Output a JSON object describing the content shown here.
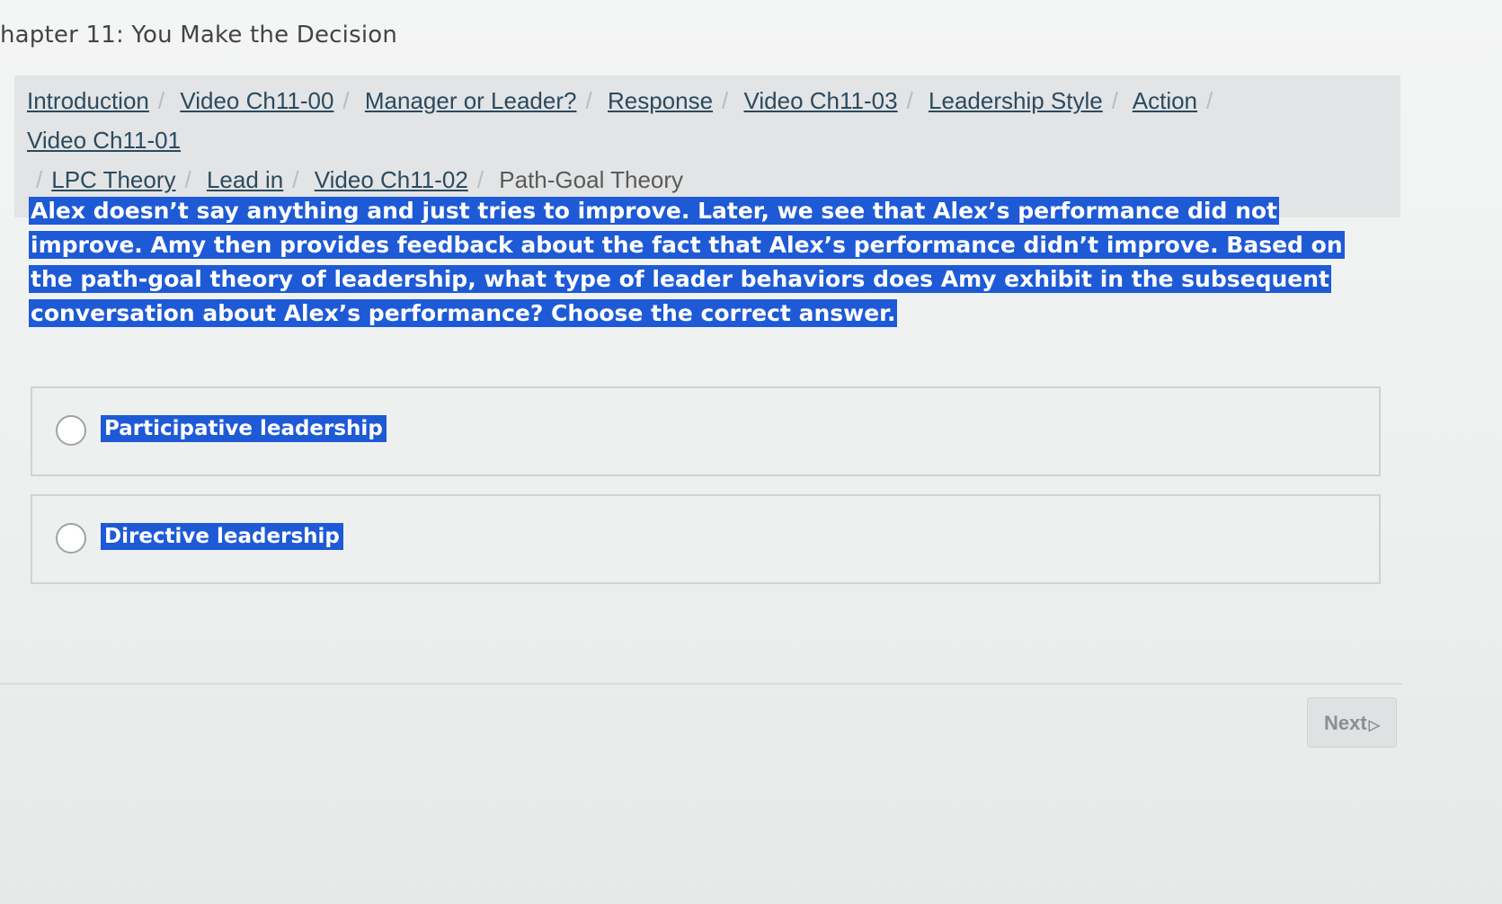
{
  "header": {
    "chapter_title": "hapter 11: You Make the Decision"
  },
  "breadcrumb": {
    "separator": "/",
    "items": [
      {
        "label": "Introduction"
      },
      {
        "label": "Video Ch11-00"
      },
      {
        "label": "Manager or Leader?"
      },
      {
        "label": "Response"
      },
      {
        "label": "Video Ch11-03"
      },
      {
        "label": "Leadership Style"
      },
      {
        "label": "Action"
      },
      {
        "label": "Video Ch11-01"
      },
      {
        "label": "LPC Theory"
      },
      {
        "label": "Lead in"
      },
      {
        "label": "Video Ch11-02"
      }
    ],
    "current": "Path-Goal Theory"
  },
  "question": {
    "text": "Alex doesn’t say anything and just tries to improve. Later, we see that Alex’s performance did not improve. Amy then provides feedback about the fact that Alex’s performance didn’t improve. Based on the path-goal theory of leadership, what type of leader behaviors does Amy exhibit in the subsequent conversation about Alex’s performance? Choose the correct answer."
  },
  "options": [
    {
      "label": "Participative leadership"
    },
    {
      "label": "Directive leadership"
    }
  ],
  "footer": {
    "next_label": "Next",
    "next_icon": "▷"
  },
  "colors": {
    "highlight": "#1e5ad6",
    "link": "#2b4a5e"
  }
}
